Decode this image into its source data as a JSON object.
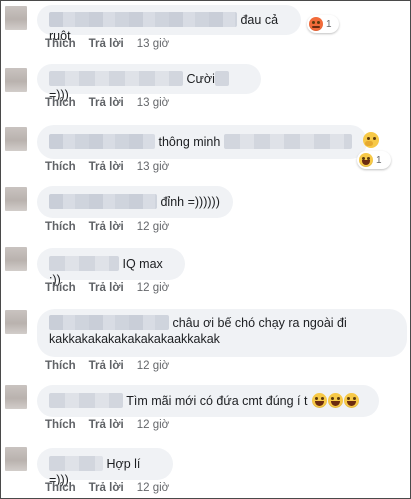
{
  "actions": {
    "like": "Thích",
    "reply": "Trả lời"
  },
  "reactions": {
    "count_one": "1"
  },
  "comments": [
    {
      "text": "đau cả ruột",
      "time": "13 giờ"
    },
    {
      "text": "Cười",
      "suffix": " =)))",
      "time": "13 giờ"
    },
    {
      "text": "thông minh",
      "time": "13 giờ"
    },
    {
      "text": "đỉnh =))))))",
      "time": "12 giờ"
    },
    {
      "text": "IQ max :))",
      "time": "12 giờ"
    },
    {
      "text": "châu ơi bế chó chạy ra ngoài đi",
      "text2": "kakkakakakakakakakaakkakak",
      "time": "12 giờ"
    },
    {
      "text": "Tìm mãi mới có đứa cmt đúng í t",
      "time": "12 giờ"
    },
    {
      "text": "Hợp lí =)))",
      "time": "12 giờ"
    }
  ],
  "icons": {
    "angry": "angry-emoji-icon",
    "laugh": "laughing-emoji-icon",
    "thinking": "thinking-emoji-icon"
  }
}
